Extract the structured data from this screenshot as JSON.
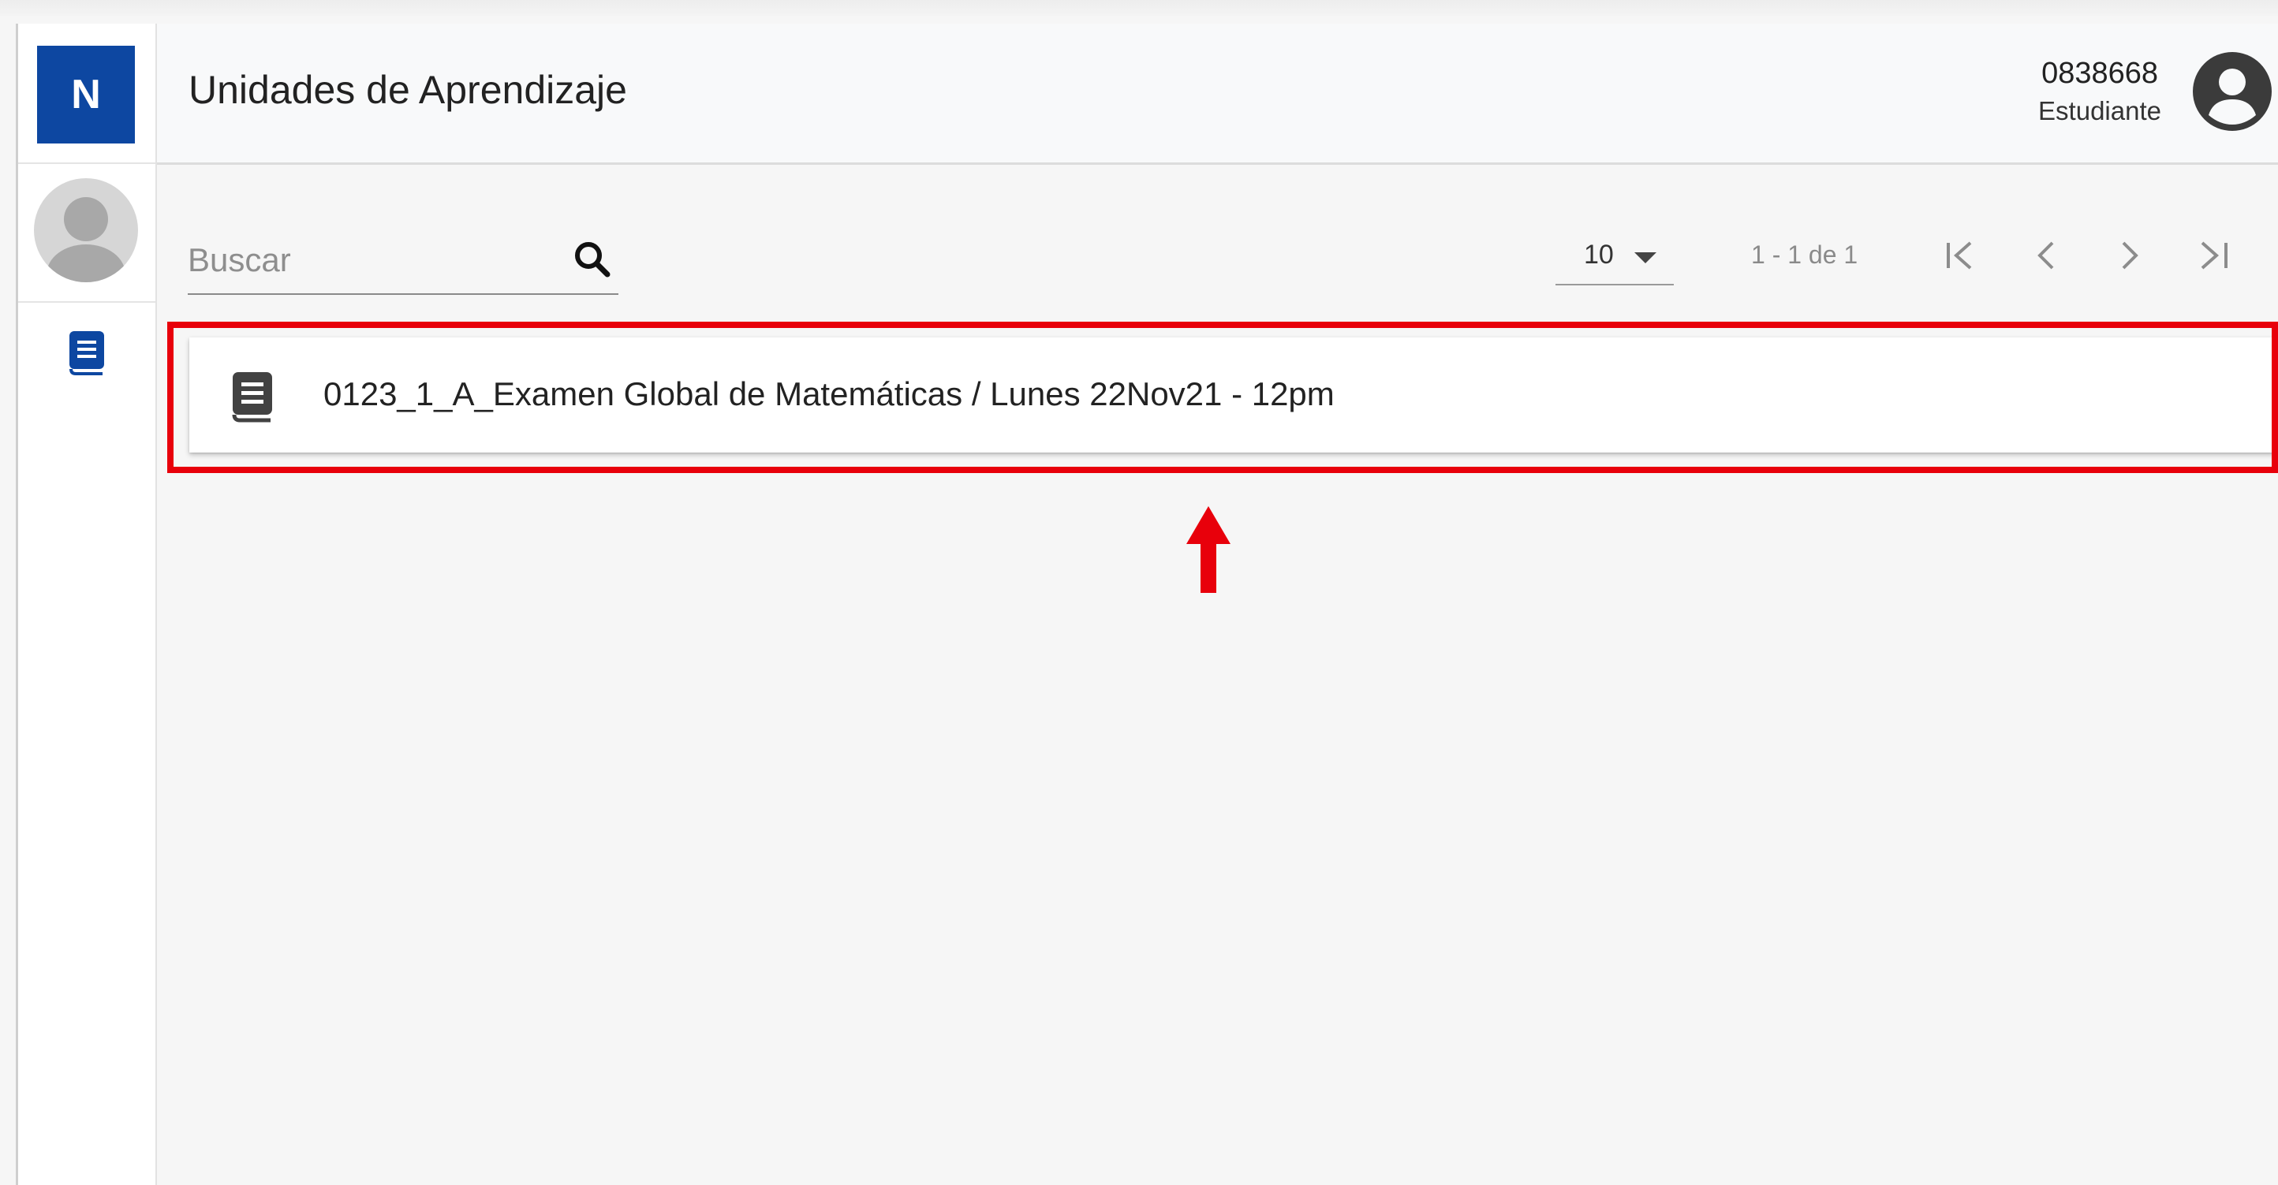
{
  "app": {
    "logo_letter": "N"
  },
  "header": {
    "title": "Unidades de Aprendizaje",
    "user_code": "0838668",
    "user_role": "Estudiante"
  },
  "search": {
    "placeholder": "Buscar",
    "value": ""
  },
  "pagination": {
    "page_size": "10",
    "range_label": "1 - 1 de 1"
  },
  "list": {
    "items": [
      {
        "label": "0123_1_A_Examen Global de Matemáticas / Lunes 22Nov21 - 12pm"
      }
    ]
  },
  "colors": {
    "brand": "#0d47a1",
    "highlight": "#e8000b",
    "icon_dark": "#424242"
  },
  "icons": {
    "sidebar_nav": "book-icon",
    "item": "book-icon",
    "search": "search-icon",
    "account": "account-circle-icon"
  }
}
